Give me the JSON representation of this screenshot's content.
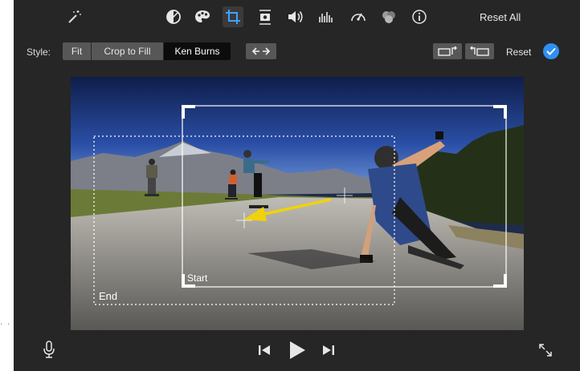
{
  "toolbar": {
    "icons": [
      "magic-wand-icon",
      "color-balance-icon",
      "color-palette-icon",
      "crop-icon",
      "stabilization-icon",
      "volume-icon",
      "noise-reduction-icon",
      "speed-icon",
      "filter-icon",
      "info-icon"
    ],
    "active": "crop-icon",
    "reset_all_label": "Reset All"
  },
  "style_bar": {
    "label": "Style:",
    "options": [
      "Fit",
      "Crop to Fill",
      "Ken Burns"
    ],
    "selected": "Ken Burns",
    "swap_icon": "swap-start-end-icon",
    "rotate_left_icon": "rotate-left-icon",
    "rotate_right_icon": "rotate-right-icon",
    "reset_label": "Reset",
    "apply_icon": "checkmark-icon"
  },
  "viewer": {
    "start_label": "Start",
    "end_label": "End"
  },
  "bottom_bar": {
    "icons": [
      "microphone-icon",
      "skip-back-icon",
      "play-icon",
      "skip-forward-icon",
      "fullscreen-icon"
    ]
  },
  "colors": {
    "background": "#262626",
    "accent": "#2f8ff0",
    "button": "#575757",
    "selected_button": "#0c0c0c",
    "motion_arrow": "#f1d20a"
  }
}
